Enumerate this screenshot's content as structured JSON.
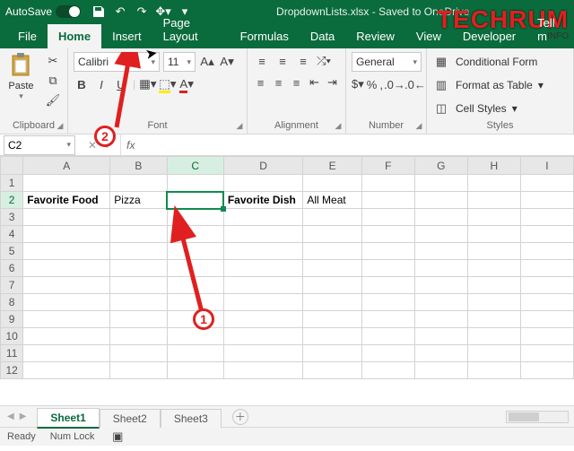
{
  "titlebar": {
    "autosave_label": "AutoSave",
    "autosave_state": "On",
    "filename": "DropdownLists.xlsx - Saved to OneDrive"
  },
  "watermark": {
    "brand": "TECHRUM",
    "sub": ".INFO"
  },
  "tabs": {
    "items": [
      "File",
      "Home",
      "Insert",
      "Page Layout",
      "Formulas",
      "Data",
      "Review",
      "View",
      "Developer",
      "Tell m"
    ],
    "active": "Home"
  },
  "ribbon": {
    "clipboard": {
      "paste": "Paste",
      "label": "Clipboard"
    },
    "font": {
      "name": "Calibri",
      "size": "11",
      "bold": "B",
      "italic": "I",
      "underline": "U",
      "label": "Font"
    },
    "alignment": {
      "label": "Alignment"
    },
    "number": {
      "format": "General",
      "label": "Number"
    },
    "styles": {
      "conditional": "Conditional Form",
      "table": "Format as Table",
      "cell": "Cell Styles",
      "label": "Styles"
    }
  },
  "formula": {
    "namebox": "C2",
    "fx": "fx",
    "value": ""
  },
  "grid": {
    "columns": [
      "A",
      "B",
      "C",
      "D",
      "E",
      "F",
      "G",
      "H",
      "I"
    ],
    "widths": [
      92,
      60,
      60,
      84,
      62,
      56,
      56,
      56,
      56
    ],
    "active_col": "C",
    "active_row": 2,
    "rows": 12,
    "cells": {
      "A2": {
        "text": "Favorite Food",
        "bold": true
      },
      "B2": {
        "text": "Pizza"
      },
      "D2": {
        "text": "Favorite Dish",
        "bold": true
      },
      "E2": {
        "text": "All Meat"
      }
    }
  },
  "sheets": {
    "items": [
      "Sheet1",
      "Sheet2",
      "Sheet3"
    ],
    "active": "Sheet1"
  },
  "status": {
    "ready": "Ready",
    "numlock": "Num Lock"
  },
  "annotations": {
    "badge1": "1",
    "badge2": "2"
  }
}
